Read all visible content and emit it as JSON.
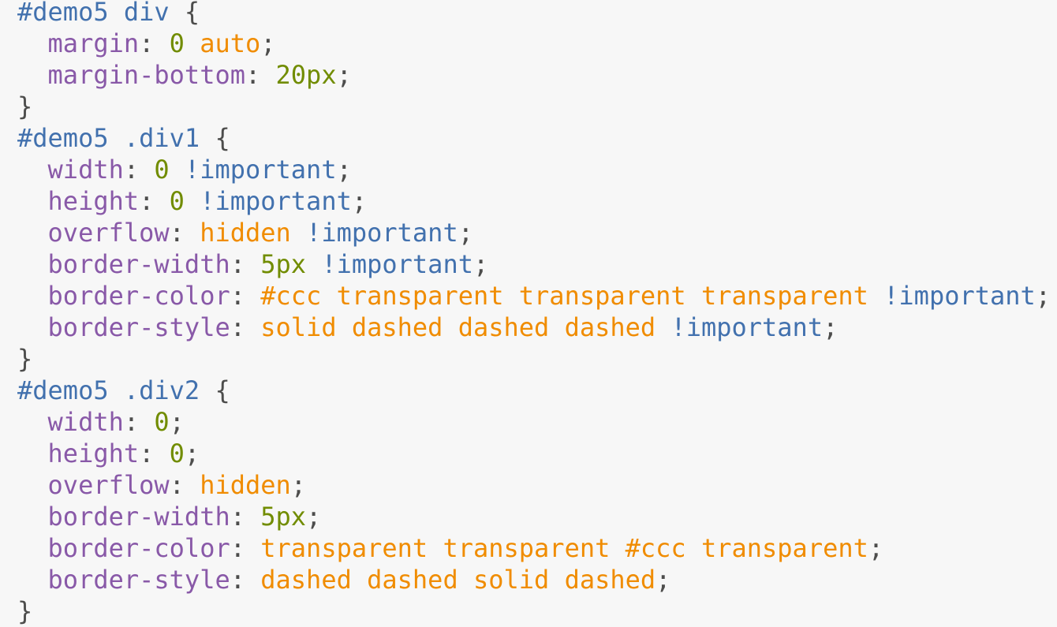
{
  "colors": {
    "background": "#f7f7f7",
    "selector": "#4271ae",
    "property": "#8959a8",
    "number": "#718c00",
    "keyword": "#f08c00",
    "important": "#4271ae",
    "punctuation": "#4d4d4c"
  },
  "code_lines": [
    [
      [
        "sel",
        "#demo5 div"
      ],
      [
        "punc",
        " {"
      ]
    ],
    [
      [
        "punc",
        "  "
      ],
      [
        "prop",
        "margin"
      ],
      [
        "punc",
        ": "
      ],
      [
        "num",
        "0"
      ],
      [
        "punc",
        " "
      ],
      [
        "kw",
        "auto"
      ],
      [
        "punc",
        ";"
      ]
    ],
    [
      [
        "punc",
        "  "
      ],
      [
        "prop",
        "margin-bottom"
      ],
      [
        "punc",
        ": "
      ],
      [
        "num",
        "20px"
      ],
      [
        "punc",
        ";"
      ]
    ],
    [
      [
        "punc",
        "}"
      ]
    ],
    [
      [
        "sel",
        "#demo5 .div1"
      ],
      [
        "punc",
        " {"
      ]
    ],
    [
      [
        "punc",
        "  "
      ],
      [
        "prop",
        "width"
      ],
      [
        "punc",
        ": "
      ],
      [
        "num",
        "0"
      ],
      [
        "punc",
        " "
      ],
      [
        "imp",
        "!important"
      ],
      [
        "punc",
        ";"
      ]
    ],
    [
      [
        "punc",
        "  "
      ],
      [
        "prop",
        "height"
      ],
      [
        "punc",
        ": "
      ],
      [
        "num",
        "0"
      ],
      [
        "punc",
        " "
      ],
      [
        "imp",
        "!important"
      ],
      [
        "punc",
        ";"
      ]
    ],
    [
      [
        "punc",
        "  "
      ],
      [
        "prop",
        "overflow"
      ],
      [
        "punc",
        ": "
      ],
      [
        "kw",
        "hidden"
      ],
      [
        "punc",
        " "
      ],
      [
        "imp",
        "!important"
      ],
      [
        "punc",
        ";"
      ]
    ],
    [
      [
        "punc",
        "  "
      ],
      [
        "prop",
        "border-width"
      ],
      [
        "punc",
        ": "
      ],
      [
        "num",
        "5px"
      ],
      [
        "punc",
        " "
      ],
      [
        "imp",
        "!important"
      ],
      [
        "punc",
        ";"
      ]
    ],
    [
      [
        "punc",
        "  "
      ],
      [
        "prop",
        "border-color"
      ],
      [
        "punc",
        ": "
      ],
      [
        "kw",
        "#ccc transparent transparent transparent"
      ],
      [
        "punc",
        " "
      ],
      [
        "imp",
        "!important"
      ],
      [
        "punc",
        ";"
      ]
    ],
    [
      [
        "punc",
        "  "
      ],
      [
        "prop",
        "border-style"
      ],
      [
        "punc",
        ": "
      ],
      [
        "kw",
        "solid dashed dashed dashed"
      ],
      [
        "punc",
        " "
      ],
      [
        "imp",
        "!important"
      ],
      [
        "punc",
        ";"
      ]
    ],
    [
      [
        "punc",
        "}"
      ]
    ],
    [
      [
        "sel",
        "#demo5 .div2"
      ],
      [
        "punc",
        " {"
      ]
    ],
    [
      [
        "punc",
        "  "
      ],
      [
        "prop",
        "width"
      ],
      [
        "punc",
        ": "
      ],
      [
        "num",
        "0"
      ],
      [
        "punc",
        ";"
      ]
    ],
    [
      [
        "punc",
        "  "
      ],
      [
        "prop",
        "height"
      ],
      [
        "punc",
        ": "
      ],
      [
        "num",
        "0"
      ],
      [
        "punc",
        ";"
      ]
    ],
    [
      [
        "punc",
        "  "
      ],
      [
        "prop",
        "overflow"
      ],
      [
        "punc",
        ": "
      ],
      [
        "kw",
        "hidden"
      ],
      [
        "punc",
        ";"
      ]
    ],
    [
      [
        "punc",
        "  "
      ],
      [
        "prop",
        "border-width"
      ],
      [
        "punc",
        ": "
      ],
      [
        "num",
        "5px"
      ],
      [
        "punc",
        ";"
      ]
    ],
    [
      [
        "punc",
        "  "
      ],
      [
        "prop",
        "border-color"
      ],
      [
        "punc",
        ": "
      ],
      [
        "kw",
        "transparent transparent #ccc transparent"
      ],
      [
        "punc",
        ";"
      ]
    ],
    [
      [
        "punc",
        "  "
      ],
      [
        "prop",
        "border-style"
      ],
      [
        "punc",
        ": "
      ],
      [
        "kw",
        "dashed dashed solid dashed"
      ],
      [
        "punc",
        ";"
      ]
    ],
    [
      [
        "punc",
        "}"
      ]
    ]
  ]
}
